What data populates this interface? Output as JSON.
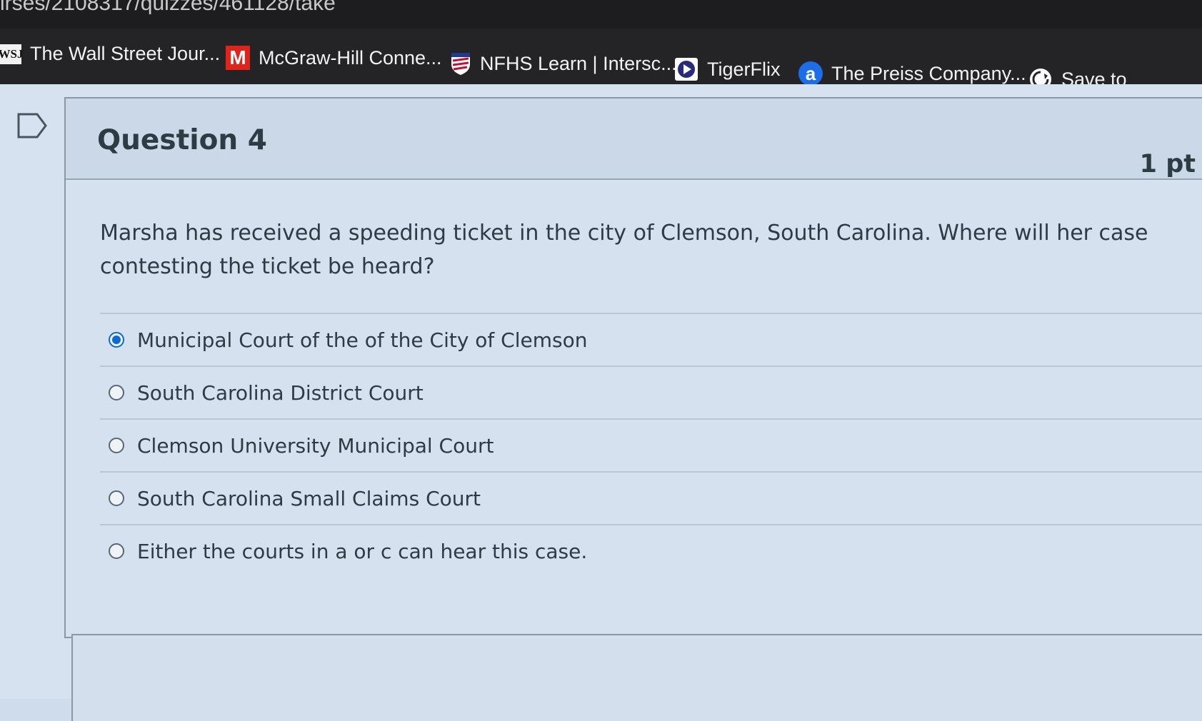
{
  "browser": {
    "url_fragment": "irses/2108317/quizzes/461128/take",
    "bookmarks": [
      {
        "label": "The Wall Street Jour...",
        "icon": "wsj-icon",
        "icon_text": "WSJ"
      },
      {
        "label": "McGraw-Hill Conne...",
        "icon": "mcgraw-hill-icon",
        "icon_text": "M"
      },
      {
        "label": "NFHS Learn | Intersc...",
        "icon": "nfhs-icon",
        "icon_text": ""
      },
      {
        "label": "TigerFlix",
        "icon": "play-icon",
        "icon_text": ""
      },
      {
        "label": "The Preiss Company...",
        "icon": "preiss-icon",
        "icon_text": "a"
      },
      {
        "label": "Save to",
        "icon": "save-icon",
        "icon_text": ""
      }
    ]
  },
  "question": {
    "title": "Question 4",
    "points": "1 pt",
    "text": "Marsha has received a speeding ticket in the city of Clemson, South Carolina. Where will her case contesting the ticket be heard?",
    "answers": [
      {
        "label": "Municipal Court of the of the City of Clemson",
        "selected": true
      },
      {
        "label": "South Carolina District Court",
        "selected": false
      },
      {
        "label": "Clemson University Municipal Court",
        "selected": false
      },
      {
        "label": "South Carolina Small Claims Court",
        "selected": false
      },
      {
        "label": "Either the courts in a or c can hear this case.",
        "selected": false
      }
    ]
  },
  "colors": {
    "accent": "#0a6bd6",
    "text": "#2d3b45",
    "mcgraw_red": "#e2231a"
  }
}
